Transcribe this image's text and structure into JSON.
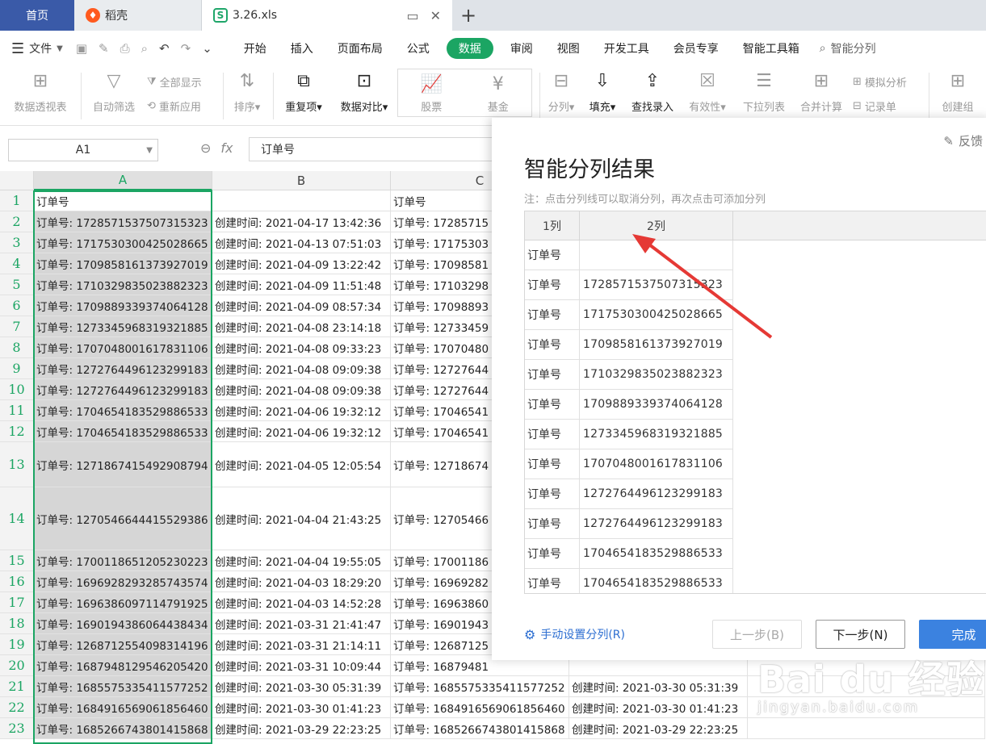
{
  "tabs": {
    "home": "首页",
    "daoke": "稻壳",
    "file": "3.26.xls",
    "add": "+"
  },
  "menubar": {
    "file": "文件",
    "items": [
      "开始",
      "插入",
      "页面布局",
      "公式",
      "数据",
      "审阅",
      "视图",
      "开发工具",
      "会员专享",
      "智能工具箱"
    ],
    "active": "数据",
    "search": "智能分列"
  },
  "ribbon": {
    "pivot": "数据透视表",
    "autofilter": "自动筛选",
    "showall": "全部显示",
    "reapply": "重新应用",
    "sort": "排序",
    "duplicate": "重复项",
    "compare": "数据对比",
    "stock": "股票",
    "fund": "基金",
    "split": "分列",
    "fill": "填充",
    "lookup": "查找录入",
    "validity": "有效性",
    "dropdown": "下拉列表",
    "merge": "合并计算",
    "simulate": "模拟分析",
    "record": "记录单",
    "group": "创建组"
  },
  "formula": {
    "namebox": "A1",
    "fx": "fx",
    "content": "订单号"
  },
  "columns": [
    "A",
    "B",
    "C"
  ],
  "rows": [
    {
      "n": "1",
      "a": "订单号",
      "b": "",
      "c": "订单号",
      "d": "",
      "h": 26
    },
    {
      "n": "2",
      "a": "订单号: 1728571537507315323",
      "b": "创建时间: 2021-04-17 13:42:36",
      "c": "订单号: 17285715",
      "d": "",
      "h": 26
    },
    {
      "n": "3",
      "a": "订单号: 1717530300425028665",
      "b": "创建时间: 2021-04-13 07:51:03",
      "c": "订单号: 17175303",
      "d": "",
      "h": 26
    },
    {
      "n": "4",
      "a": "订单号: 1709858161373927019",
      "b": "创建时间: 2021-04-09 13:22:42",
      "c": "订单号: 17098581",
      "d": "",
      "h": 26
    },
    {
      "n": "5",
      "a": "订单号: 1710329835023882323",
      "b": "创建时间: 2021-04-09 11:51:48",
      "c": "订单号: 17103298",
      "d": "",
      "h": 26
    },
    {
      "n": "6",
      "a": "订单号: 1709889339374064128",
      "b": "创建时间: 2021-04-09 08:57:34",
      "c": "订单号: 17098893",
      "d": "",
      "h": 26
    },
    {
      "n": "7",
      "a": "订单号: 1273345968319321885",
      "b": "创建时间: 2021-04-08 23:14:18",
      "c": "订单号: 12733459",
      "d": "",
      "h": 26
    },
    {
      "n": "8",
      "a": "订单号: 1707048001617831106",
      "b": "创建时间: 2021-04-08 09:33:23",
      "c": "订单号: 17070480",
      "d": "",
      "h": 26
    },
    {
      "n": "9",
      "a": "订单号: 1272764496123299183",
      "b": "创建时间: 2021-04-08 09:09:38",
      "c": "订单号: 12727644",
      "d": "",
      "h": 26
    },
    {
      "n": "10",
      "a": "订单号: 1272764496123299183",
      "b": "创建时间: 2021-04-08 09:09:38",
      "c": "订单号: 12727644",
      "d": "",
      "h": 26
    },
    {
      "n": "11",
      "a": "订单号: 1704654183529886533",
      "b": "创建时间: 2021-04-06 19:32:12",
      "c": "订单号: 17046541",
      "d": "",
      "h": 26
    },
    {
      "n": "12",
      "a": "订单号: 1704654183529886533",
      "b": "创建时间: 2021-04-06 19:32:12",
      "c": "订单号: 17046541",
      "d": "",
      "h": 26
    },
    {
      "n": "13",
      "a": "订单号: 1271867415492908794",
      "b": "创建时间: 2021-04-05 12:05:54",
      "c": "订单号: 12718674",
      "d": "",
      "h": 56
    },
    {
      "n": "14",
      "a": "订单号: 1270546644415529386",
      "b": "创建时间: 2021-04-04 21:43:25",
      "c": "订单号: 12705466",
      "d": "",
      "h": 78
    },
    {
      "n": "15",
      "a": "订单号: 1700118651205230223",
      "b": "创建时间: 2021-04-04 19:55:05",
      "c": "订单号: 17001186",
      "d": "",
      "h": 26
    },
    {
      "n": "16",
      "a": "订单号: 1696928293285743574",
      "b": "创建时间: 2021-04-03 18:29:20",
      "c": "订单号: 16969282",
      "d": "",
      "h": 26
    },
    {
      "n": "17",
      "a": "订单号: 1696386097114791925",
      "b": "创建时间: 2021-04-03 14:52:28",
      "c": "订单号: 16963860",
      "d": "",
      "h": 26
    },
    {
      "n": "18",
      "a": "订单号: 1690194386064438434",
      "b": "创建时间: 2021-03-31 21:41:47",
      "c": "订单号: 16901943",
      "d": "",
      "h": 26
    },
    {
      "n": "19",
      "a": "订单号: 1268712554098314196",
      "b": "创建时间: 2021-03-31 21:14:11",
      "c": "订单号: 12687125",
      "d": "",
      "h": 26
    },
    {
      "n": "20",
      "a": "订单号: 1687948129546205420",
      "b": "创建时间: 2021-03-31 10:09:44",
      "c": "订单号: 16879481",
      "d": "",
      "h": 26
    },
    {
      "n": "21",
      "a": "订单号: 1685575335411577252",
      "b": "创建时间: 2021-03-30 05:31:39",
      "c": "订单号: 1685575335411577252",
      "d": "创建时间: 2021-03-30 05:31:39",
      "h": 26
    },
    {
      "n": "22",
      "a": "订单号: 1684916569061856460",
      "b": "创建时间: 2021-03-30 01:41:23",
      "c": "订单号: 1684916569061856460",
      "d": "创建时间: 2021-03-30 01:41:23",
      "h": 26
    },
    {
      "n": "23",
      "a": "订单号: 1685266743801415868",
      "b": "创建时间: 2021-03-29 22:23:25",
      "c": "订单号: 1685266743801415868",
      "d": "创建时间: 2021-03-29 22:23:25",
      "h": 26
    }
  ],
  "dialog": {
    "feedback": "反馈",
    "title": "智能分列结果",
    "note": "注：点击分列线可以取消分列，再次点击可添加分列",
    "headers": [
      "1列",
      "2列"
    ],
    "rows": [
      [
        "订单号",
        ""
      ],
      [
        "订单号",
        "1728571537507315323"
      ],
      [
        "订单号",
        "1717530300425028665"
      ],
      [
        "订单号",
        "1709858161373927019"
      ],
      [
        "订单号",
        "1710329835023882323"
      ],
      [
        "订单号",
        "1709889339374064128"
      ],
      [
        "订单号",
        "1273345968319321885"
      ],
      [
        "订单号",
        "1707048001617831106"
      ],
      [
        "订单号",
        "1272764496123299183"
      ],
      [
        "订单号",
        "1272764496123299183"
      ],
      [
        "订单号",
        "1704654183529886533"
      ],
      [
        "订单号",
        "1704654183529886533"
      ]
    ],
    "manual": "手动设置分列(R)",
    "prev": "上一步(B)",
    "next": "下一步(N)",
    "done": "完成"
  },
  "watermark": {
    "big": "Bai du 经验",
    "small": "jingyan.baidu.com"
  },
  "colors": {
    "accent_green": "#1ba563",
    "home_tab": "#3a5aa8",
    "primary_blue": "#3b82e0",
    "arrow_red": "#e53935"
  }
}
